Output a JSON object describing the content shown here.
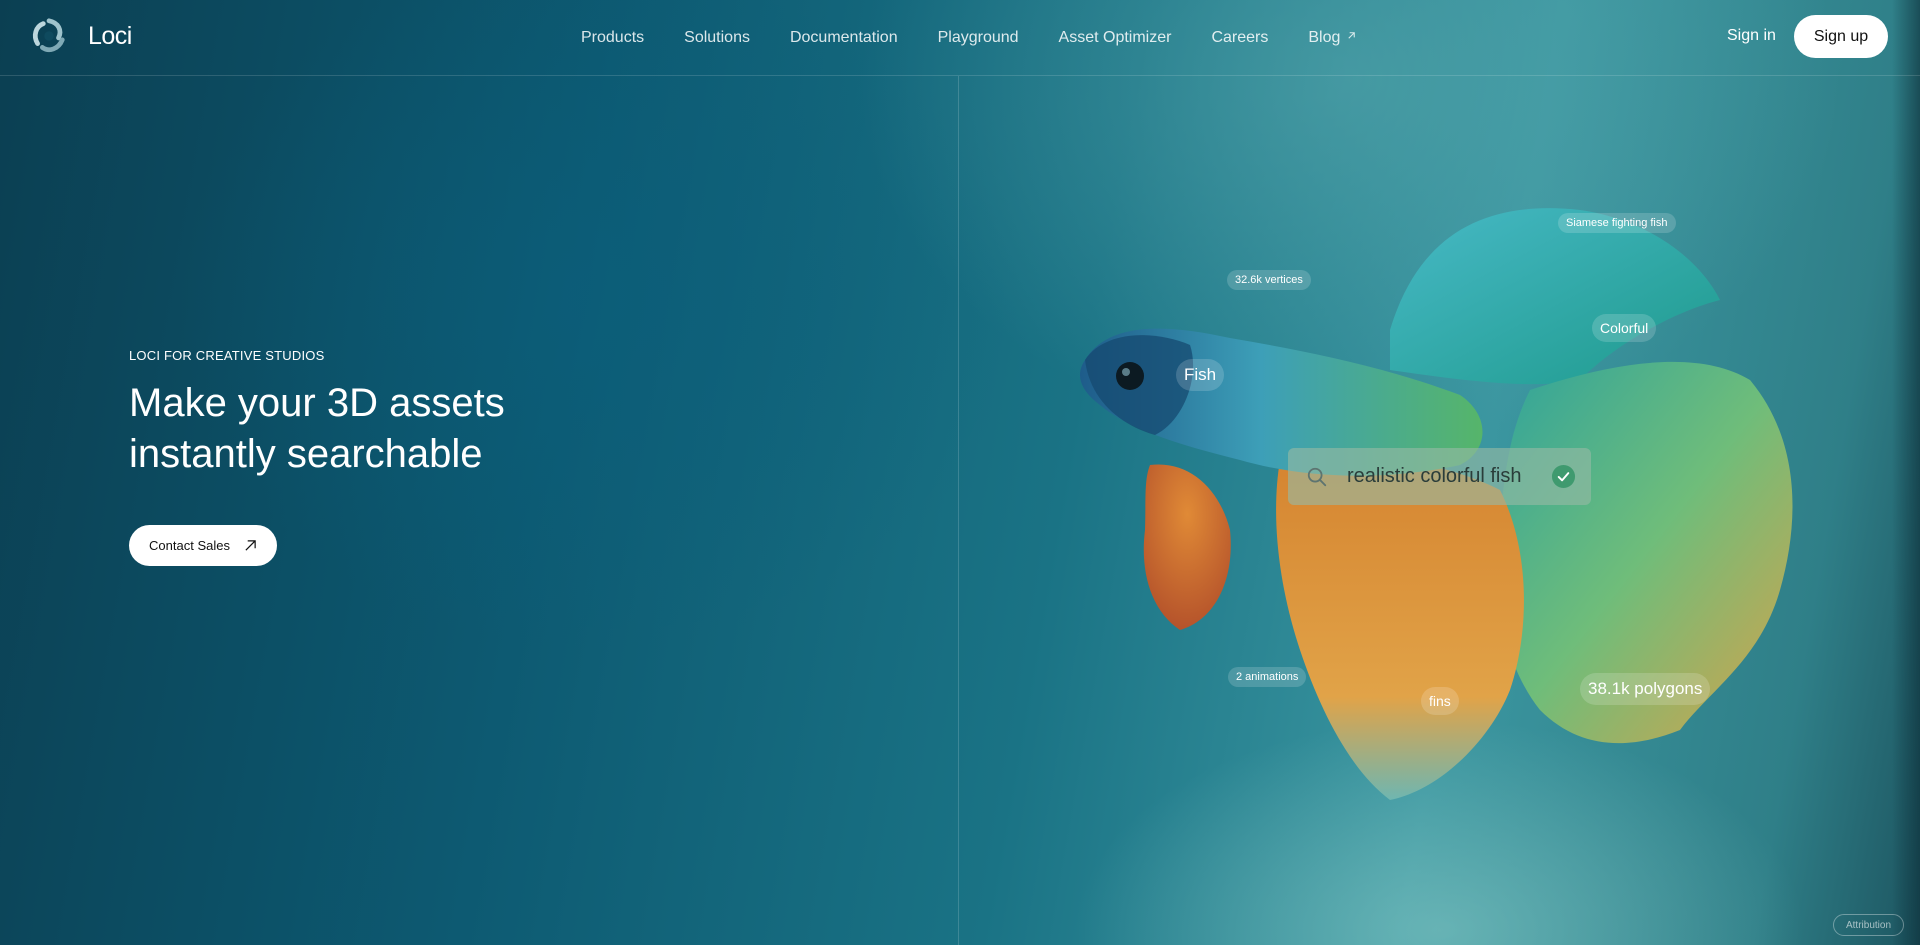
{
  "brand": {
    "name": "Loci",
    "logo_icon": "loci-swirl-logo"
  },
  "nav": {
    "items": [
      {
        "label": "Products"
      },
      {
        "label": "Solutions"
      },
      {
        "label": "Documentation"
      },
      {
        "label": "Playground"
      },
      {
        "label": "Asset Optimizer"
      },
      {
        "label": "Careers"
      },
      {
        "label": "Blog",
        "icon": "external-link-icon"
      }
    ],
    "sign_in": "Sign in",
    "sign_up": "Sign up"
  },
  "hero": {
    "eyebrow": "LOCI FOR CREATIVE STUDIOS",
    "headline": "Make your 3D assets instantly searchable",
    "cta": {
      "label": "Contact Sales",
      "icon": "arrow-up-right-icon"
    }
  },
  "showcase": {
    "tags": {
      "siamese": "Siamese fighting fish",
      "vertices": "32.6k vertices",
      "colorful": "Colorful",
      "fish": "Fish",
      "animations": "2 animations",
      "fins": "fins",
      "polygons": "38.1k polygons"
    },
    "search": {
      "query": "realistic colorful fish",
      "icon": "search-icon",
      "status_icon": "check-icon"
    }
  },
  "attribution": "Attribution",
  "colors": {
    "background_dark": "#0b3f52",
    "background_light": "#3b96a0",
    "button_bg": "#ffffff",
    "check_green": "#3f9a6f"
  }
}
